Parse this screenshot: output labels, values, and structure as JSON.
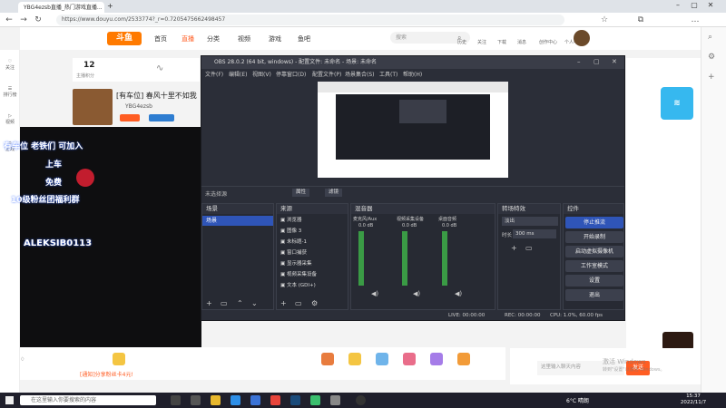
{
  "browser": {
    "tabs": [
      "YBG4ezsb直播_热门游戏直播...",
      ""
    ],
    "url": "https://www.douyu.com/2533774?_r=0.7205475662498457"
  },
  "site": {
    "logo": "斗鱼",
    "nav": [
      "首页",
      "直播",
      "分类",
      "视频",
      "游戏",
      "鱼吧"
    ],
    "search_placeholder": "搜索",
    "header_icons": [
      "历史",
      "关注",
      "下载",
      "消息",
      "创作中心",
      "个人中心"
    ],
    "stream_title": "[有车位] 春风十里不如我",
    "streamer": "YBG4ezsb",
    "follow_count": "12",
    "follow_label": "主播积分",
    "banner_text": "有车位 老铁们 可加入",
    "banner_lines": [
      "上车",
      "免费",
      "10级粉丝团福利群"
    ],
    "tiktok_id": "ALEKSIB0113",
    "bottom_notice": "[通知]分享粉丝卡4元!",
    "chat_placeholder": "这里输入聊天内容",
    "send": "发送"
  },
  "obs": {
    "title": "OBS 28.0.2 (64 bit, windows) - 配置文件: 未命名 - 场景: 未命名",
    "menu": [
      "文件(F)",
      "编辑(E)",
      "视图(V)",
      "停靠窗口(D)",
      "配置文件(P)",
      "场景集合(S)",
      "工具(T)",
      "帮助(H)"
    ],
    "no_source": "未选择源",
    "properties": "属性",
    "filters": "滤镜",
    "docks": {
      "scenes": "场景",
      "sources": "来源",
      "mixer": "混音器",
      "transitions": "转场特效",
      "controls": "控件"
    },
    "scene_item": "场景",
    "sources": [
      "浏览器",
      "图像 3",
      "未标题-1",
      "窗口捕获",
      "显示器采集",
      "视频采集设备",
      "文本 (GDI+)"
    ],
    "mixer_channels": [
      {
        "name": "麦克风/Aux",
        "db": "0.0 dB"
      },
      {
        "name": "视频采集设备",
        "db": "0.0 dB"
      },
      {
        "name": "桌面音频",
        "db": "0.0 dB"
      }
    ],
    "transition": "淡出",
    "duration_label": "时长",
    "duration": "300 ms",
    "controls": [
      "停止推流",
      "开始录制",
      "启动虚拟摄像机",
      "工作室模式",
      "设置",
      "退出"
    ],
    "status": {
      "live": "LIVE: 00:00:00",
      "rec": "REC: 00:00:00",
      "cpu": "CPU: 1.0%, 60.00 fps"
    }
  },
  "taskbar": {
    "search_placeholder": "在这里输入你要搜索的内容",
    "weather": "6°C 晴朗",
    "time": "15:37",
    "date": "2022/11/7"
  },
  "watermark": "激活 Windows",
  "watermark_sub": "转到\"设置\"以激活 Windows。"
}
